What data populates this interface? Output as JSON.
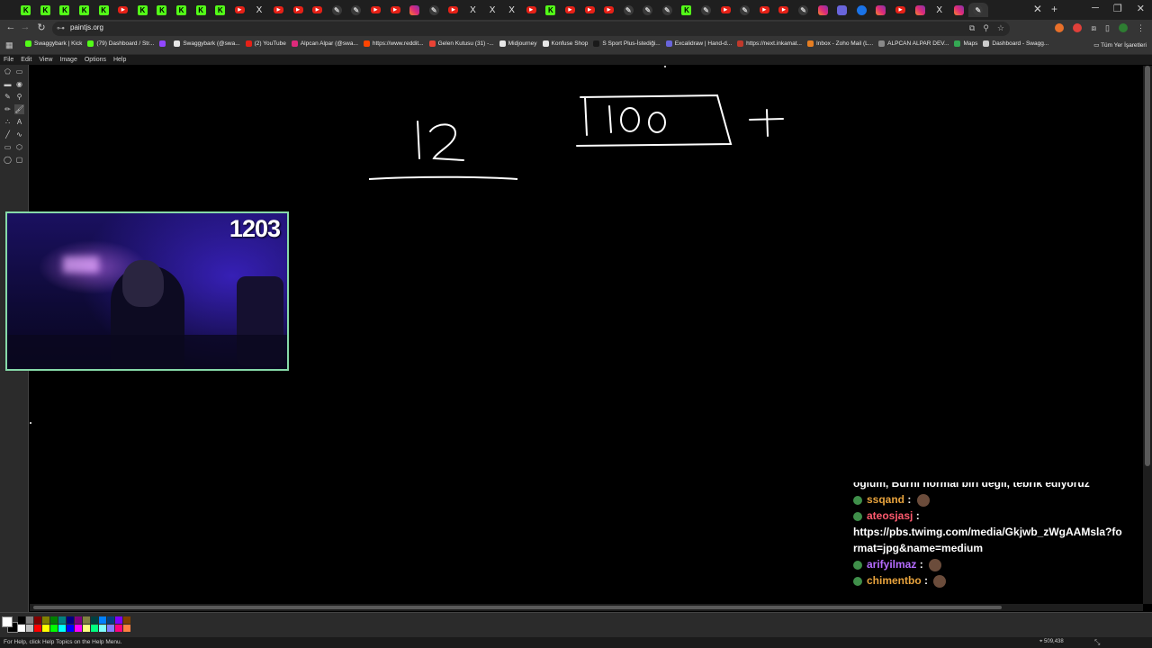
{
  "browser": {
    "tabs": [
      {
        "icon": "kick-icon",
        "glyph": "K"
      },
      {
        "icon": "kick-icon",
        "glyph": "K"
      },
      {
        "icon": "kick-icon",
        "glyph": "K"
      },
      {
        "icon": "kick-icon",
        "glyph": "K"
      },
      {
        "icon": "kick-icon",
        "glyph": "K"
      },
      {
        "icon": "youtube-icon",
        "glyph": "▶"
      },
      {
        "icon": "kick-icon",
        "glyph": "K"
      },
      {
        "icon": "kick-icon",
        "glyph": "K"
      },
      {
        "icon": "kick-icon",
        "glyph": "K"
      },
      {
        "icon": "kick-icon",
        "glyph": "K"
      },
      {
        "icon": "kick-icon",
        "glyph": "K"
      },
      {
        "icon": "youtube-icon",
        "glyph": "▶"
      },
      {
        "icon": "x-icon",
        "glyph": "X"
      },
      {
        "icon": "youtube-icon",
        "glyph": "▶"
      },
      {
        "icon": "youtube-icon",
        "glyph": "▶"
      },
      {
        "icon": "youtube-icon",
        "glyph": "▶"
      },
      {
        "icon": "pen-icon",
        "glyph": "✎"
      },
      {
        "icon": "pen-icon",
        "glyph": "✎"
      },
      {
        "icon": "youtube-icon",
        "glyph": "▶"
      },
      {
        "icon": "youtube-icon",
        "glyph": "▶"
      },
      {
        "icon": "instagram-icon",
        "glyph": ""
      },
      {
        "icon": "pen-icon",
        "glyph": "✎"
      },
      {
        "icon": "youtube-icon",
        "glyph": "▶"
      },
      {
        "icon": "x-icon",
        "glyph": "X"
      },
      {
        "icon": "x-icon",
        "glyph": "X"
      },
      {
        "icon": "x-icon",
        "glyph": "X"
      },
      {
        "icon": "youtube-icon",
        "glyph": "▶"
      },
      {
        "icon": "kick-icon",
        "glyph": "K"
      },
      {
        "icon": "youtube-icon",
        "glyph": "▶"
      },
      {
        "icon": "youtube-icon",
        "glyph": "▶"
      },
      {
        "icon": "youtube-icon",
        "glyph": "▶"
      },
      {
        "icon": "pen-icon",
        "glyph": "✎"
      },
      {
        "icon": "pen-icon",
        "glyph": "✎"
      },
      {
        "icon": "pen-icon",
        "glyph": "✎"
      },
      {
        "icon": "kick-icon",
        "glyph": "K"
      },
      {
        "icon": "pen-icon",
        "glyph": "✎"
      },
      {
        "icon": "youtube-icon",
        "glyph": "▶"
      },
      {
        "icon": "pen-icon",
        "glyph": "✎"
      },
      {
        "icon": "youtube-icon",
        "glyph": "▶"
      },
      {
        "icon": "youtube-icon",
        "glyph": "▶"
      },
      {
        "icon": "pen-icon",
        "glyph": "✎"
      },
      {
        "icon": "instagram-icon",
        "glyph": ""
      },
      {
        "icon": "excalidraw-icon",
        "glyph": ""
      },
      {
        "icon": "globe-icon",
        "glyph": ""
      },
      {
        "icon": "instagram-icon",
        "glyph": ""
      },
      {
        "icon": "youtube-icon",
        "glyph": "▶"
      },
      {
        "icon": "instagram-icon",
        "glyph": ""
      },
      {
        "icon": "x-icon",
        "glyph": "X"
      },
      {
        "icon": "instagram-icon",
        "glyph": ""
      },
      {
        "icon": "pen-icon",
        "glyph": "✎",
        "active": true
      }
    ],
    "url": "paintjs.org",
    "bookmarks": [
      {
        "label": "Swaggybark | Kick",
        "color": "#53fc18"
      },
      {
        "label": "(79) Dashboard / Str...",
        "color": "#53fc18"
      },
      {
        "label": "",
        "color": "#9146ff"
      },
      {
        "label": "Swaggybark (@swa...",
        "color": "#e6e6e6"
      },
      {
        "label": "(2) YouTube",
        "color": "#e62117"
      },
      {
        "label": "Alpcan Alpar (@swa...",
        "color": "#dd2a7b"
      },
      {
        "label": "https://www.reddit...",
        "color": "#ff4500"
      },
      {
        "label": "Gelen Kutusu (31) -...",
        "color": "#ea4335"
      },
      {
        "label": "Midjourney",
        "color": "#e6e6e6"
      },
      {
        "label": "Konfuse Shop",
        "color": "#e6e6e6"
      },
      {
        "label": "S Sport Plus-İstediği...",
        "color": "#1a1a1a"
      },
      {
        "label": "Excalidraw | Hand-d...",
        "color": "#6965db"
      },
      {
        "label": "https://next.inkamat...",
        "color": "#c0392b"
      },
      {
        "label": "Inbox - Zoho Mail (L...",
        "color": "#e67e22"
      },
      {
        "label": "ALPCAN ALPAR DEV...",
        "color": "#888888"
      },
      {
        "label": "Maps",
        "color": "#34a853"
      },
      {
        "label": "Dashboard - Swagg...",
        "color": "#cccccc"
      }
    ],
    "other_bookmarks": "Tüm Yer İşaretleri"
  },
  "app": {
    "menu": [
      "File",
      "Edit",
      "View",
      "Image",
      "Options",
      "Help"
    ],
    "tools": [
      "free-select-icon",
      "select-icon",
      "eraser-icon",
      "fill-icon",
      "color-picker-icon",
      "magnifier-icon",
      "pencil-icon",
      "brush-icon",
      "airbrush-icon",
      "text-icon",
      "line-icon",
      "curve-icon",
      "rectangle-icon",
      "polygon-icon",
      "ellipse-icon",
      "rounded-rectangle-icon"
    ],
    "palette": [
      "#000000",
      "#808080",
      "#800000",
      "#808000",
      "#008000",
      "#008080",
      "#000080",
      "#800080",
      "#808040",
      "#004040",
      "#0080ff",
      "#004080",
      "#8000ff",
      "#804000",
      "#ffffff",
      "#c0c0c0",
      "#ff0000",
      "#ffff00",
      "#00ff00",
      "#00ffff",
      "#0000ff",
      "#ff00ff",
      "#ffff80",
      "#00ff80",
      "#80ffff",
      "#8080ff",
      "#ff0080",
      "#ff8040"
    ],
    "status_text": "For Help, click Help Topics on the Help Menu.",
    "coords": "509,438"
  },
  "canvas_drawing": {
    "numbers": [
      "12",
      "100"
    ],
    "symbols": [
      "+"
    ]
  },
  "stream": {
    "viewer_count": "1203",
    "chat": {
      "cut_line": "oğlum, Burni normal biri değil, tebrik ediyoruz",
      "messages": [
        {
          "user": "ssqand",
          "color": "#e8a33d",
          "text": "",
          "emote": true
        },
        {
          "user": "ateosjasj",
          "color": "#ff5a6e",
          "text": "https://pbs.twimg.com/media/Gkjwb_zWgAAMsla?format=jpg&name=medium",
          "emote": false
        },
        {
          "user": "arifyilmaz",
          "color": "#b56cff",
          "text": "",
          "emote": true
        },
        {
          "user": "chimentbo",
          "color": "#e8a33d",
          "text": "",
          "emote": true
        }
      ]
    }
  }
}
